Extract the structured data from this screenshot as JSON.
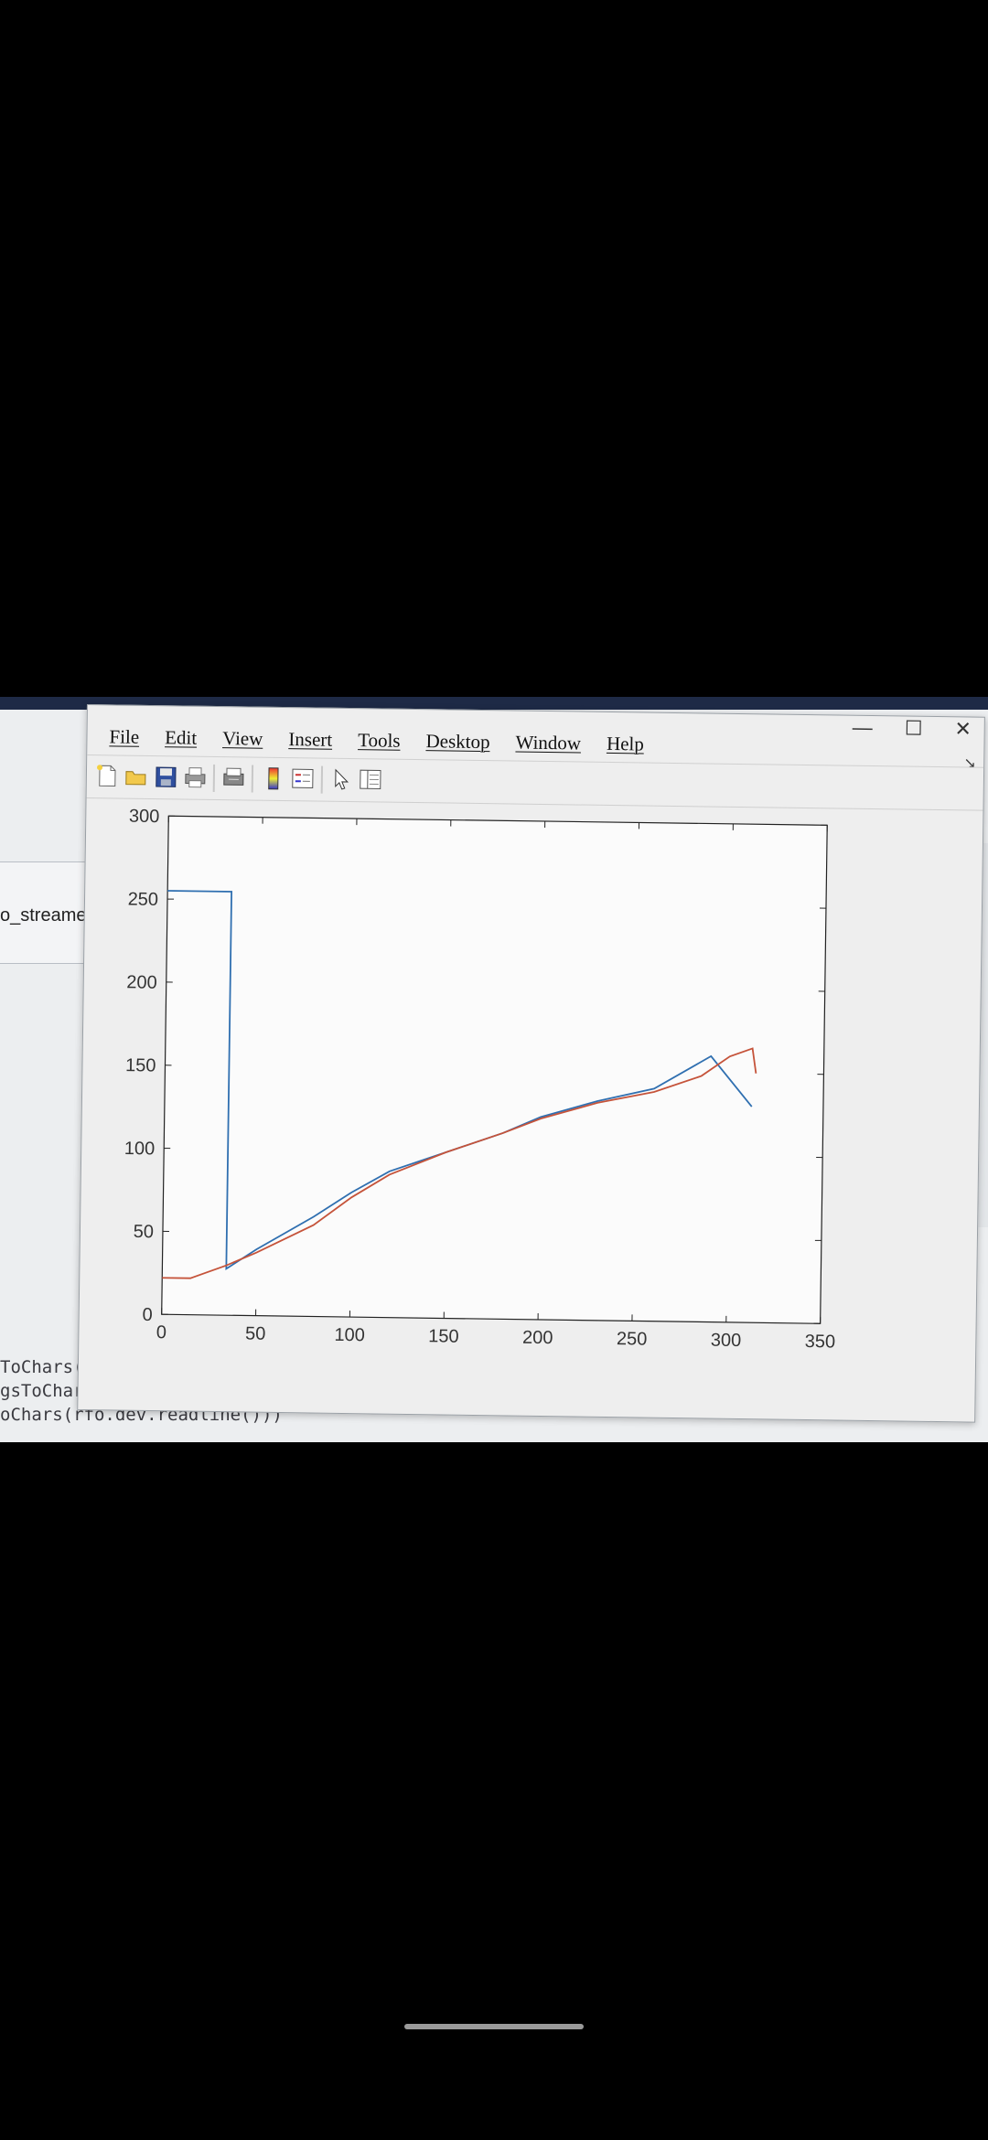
{
  "background": {
    "panel_label": "o_streame",
    "code_lines": [
      "ToChars(rf",
      "gsToChars(rfo.dev.readline()))",
      "oChars(rfo.dev.readline()))"
    ]
  },
  "figure": {
    "window_buttons": {
      "minimize": "—",
      "maximize": "☐",
      "close": "✕"
    },
    "menu": [
      "File",
      "Edit",
      "View",
      "Insert",
      "Tools",
      "Desktop",
      "Window",
      "Help"
    ],
    "toolbar_icons": [
      "new-figure-icon",
      "open-file-icon",
      "save-icon",
      "print-icon",
      "print-preview-icon",
      "colorbar-icon",
      "legend-icon",
      "pointer-icon",
      "property-editor-icon"
    ],
    "dock_arrow": "↘"
  },
  "chart_data": {
    "type": "line",
    "title": "",
    "xlabel": "",
    "ylabel": "",
    "xlim": [
      0,
      350
    ],
    "ylim": [
      0,
      300
    ],
    "xticks": [
      0,
      50,
      100,
      150,
      200,
      250,
      300,
      350
    ],
    "yticks": [
      0,
      50,
      100,
      150,
      200,
      250,
      300
    ],
    "grid": false,
    "series": [
      {
        "color": "#2f6fb0",
        "x": [
          0,
          34,
          34,
          50,
          80,
          100,
          120,
          150,
          180,
          200,
          230,
          260,
          290,
          312
        ],
        "y": [
          255,
          255,
          28,
          40,
          60,
          75,
          88,
          100,
          112,
          122,
          132,
          140,
          160,
          130
        ]
      },
      {
        "color": "#c5533a",
        "x": [
          0,
          15,
          34,
          50,
          80,
          100,
          120,
          150,
          180,
          200,
          230,
          260,
          285,
          300,
          312,
          314
        ],
        "y": [
          22,
          22,
          30,
          38,
          55,
          72,
          86,
          100,
          112,
          121,
          131,
          138,
          148,
          160,
          165,
          150
        ]
      }
    ]
  }
}
